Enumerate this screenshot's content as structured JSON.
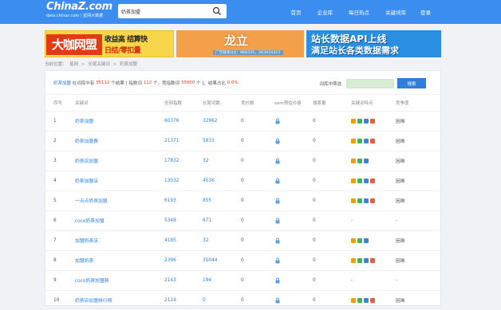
{
  "header": {
    "logo_main": "ChinaZ.com",
    "logo_sub": "data.chinaz.com | 星网大数据",
    "search_value": "奶茶加盟",
    "nav": [
      "首页",
      "企业库",
      "每日热点",
      "关键词库",
      "登录"
    ]
  },
  "banners": {
    "b1": {
      "big": "大咖网盟",
      "line1": "收益高 结算快",
      "line2": "日结/零扣量"
    },
    "b2": {
      "title": "龙立",
      "sub": "广告联系QQ：988335、363654321"
    },
    "b3": {
      "line1": "站长数据API上线",
      "line2": "满足站长各类数据需求"
    }
  },
  "breadcrumb": [
    "当前位置：",
    "星网",
    ">",
    "长尾关键词",
    ">",
    "奶茶加盟"
  ],
  "summary": {
    "keyword": "奶茶加盟",
    "t1": "在词库中有",
    "total": "35112",
    "t2": "个结果 [ 指数词",
    "index_count": "112",
    "t3": "个，竞指数词",
    "comp_count": "35000",
    "t4": "个 ]，结果占比",
    "ratio": "0.0%",
    "filter_label": "词库中筛选",
    "filter_button": "搜索"
  },
  "columns": [
    "序号",
    "关键词",
    "全网指数",
    "长尾词数",
    "竞价数",
    "sem预估价格",
    "搜索量",
    "关键词特点",
    "竞争度"
  ],
  "rows": [
    {
      "no": "1",
      "kw": "奶茶加盟",
      "idx": "60376",
      "tail": "32962",
      "bid": "0",
      "sem": "lock",
      "vol": "0",
      "tags": [
        "o",
        "g",
        "b",
        "r"
      ],
      "comp": "困难"
    },
    {
      "no": "2",
      "kw": "奶茶加盟费",
      "idx": "21371",
      "tail": "5833",
      "bid": "0",
      "sem": "lock",
      "vol": "0",
      "tags": [
        "o",
        "g",
        "b",
        "r"
      ],
      "comp": "困难"
    },
    {
      "no": "3",
      "kw": "奶茶店加盟",
      "idx": "17832",
      "tail": "32",
      "bid": "0",
      "sem": "lock",
      "vol": "0",
      "tags": [
        "o",
        "g",
        "b"
      ],
      "comp": "困难"
    },
    {
      "no": "4",
      "kw": "奶茶加盟店",
      "idx": "13032",
      "tail": "4536",
      "bid": "0",
      "sem": "lock",
      "vol": "0",
      "tags": [
        "o",
        "g",
        "b",
        "r"
      ],
      "comp": "困难"
    },
    {
      "no": "5",
      "kw": "一点点奶茶加盟",
      "idx": "6193",
      "tail": "855",
      "bid": "0",
      "sem": "lock",
      "vol": "0",
      "tags": [
        "o",
        "g",
        "b",
        "r"
      ],
      "comp": "困难"
    },
    {
      "no": "6",
      "kw": "coco奶茶加盟",
      "idx": "5348",
      "tail": "871",
      "bid": "0",
      "sem": "lock",
      "vol": "0",
      "tags": [],
      "comp": "-"
    },
    {
      "no": "7",
      "kw": "加盟奶茶店",
      "idx": "4185",
      "tail": "32",
      "bid": "0",
      "sem": "lock",
      "vol": "0",
      "tags": [
        "o",
        "g",
        "b"
      ],
      "comp": "困难"
    },
    {
      "no": "8",
      "kw": "加盟奶茶",
      "idx": "2396",
      "tail": "35044",
      "bid": "0",
      "sem": "lock",
      "vol": "0",
      "tags": [
        "o",
        "g",
        "b",
        "r"
      ],
      "comp": "困难"
    },
    {
      "no": "9",
      "kw": "coco奶茶加盟费",
      "idx": "2143",
      "tail": "194",
      "bid": "0",
      "sem": "lock",
      "vol": "0",
      "tags": [],
      "comp": "-"
    },
    {
      "no": "10",
      "kw": "奶茶店加盟排行榜",
      "idx": "2119",
      "tail": "0",
      "bid": "0",
      "sem": "lock",
      "vol": "0",
      "tags": [
        "o",
        "g",
        "b",
        "r"
      ],
      "comp": "困难"
    }
  ],
  "colors": {
    "primary": "#3b8ef0",
    "link": "#2f7fd8",
    "highlight": "#e2421c"
  }
}
